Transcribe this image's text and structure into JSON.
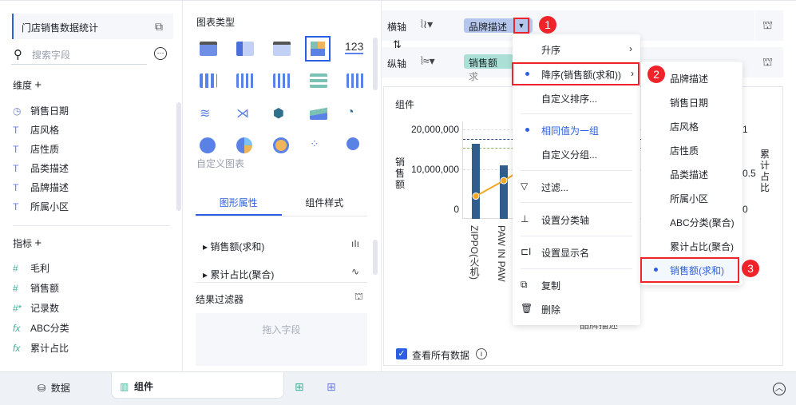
{
  "left": {
    "title": "门店销售数据统计",
    "search_placeholder": "搜索字段",
    "dimension_header": "维度",
    "dimensions": [
      "销售日期",
      "店风格",
      "店性质",
      "品类描述",
      "品牌描述",
      "所属小区"
    ],
    "measure_header": "指标",
    "measures": [
      "毛利",
      "销售额",
      "记录数",
      "ABC分类",
      "累计占比"
    ]
  },
  "middle": {
    "chart_type_title": "图表类型",
    "custom_chart": "自定义图表",
    "number_icon": "123",
    "tabs": [
      "图形属性",
      "组件样式"
    ],
    "properties": [
      "销售额(求和)",
      "累计占比(聚合)"
    ],
    "result_filter": "结果过滤器",
    "drop_hint": "拖入字段"
  },
  "axes": {
    "x_label": "横轴",
    "y_label": "纵轴",
    "x_field": "品牌描述",
    "y_field": "销售额",
    "y_field_suffix": "求"
  },
  "chart": {
    "title": "组件",
    "y_title": "销售额",
    "y2_title": "累计占比",
    "y_ticks": [
      "20,000,000",
      "10,000,000",
      "0"
    ],
    "y2_ticks": [
      "1",
      "0.5",
      "0"
    ],
    "categories": [
      "ZIPPO(火机)",
      "PAW IN PAW"
    ],
    "x_title": "品牌描述",
    "view_all": "查看所有数据",
    "bar_color": "#2f5d8c",
    "line_color": "#f5a623"
  },
  "chart_data": {
    "type": "bar",
    "categories": [
      "ZIPPO(火机)",
      "PAW IN PAW"
    ],
    "series": [
      {
        "values": [
          16500000,
          11000000
        ]
      },
      {
        "values": [
          0.17,
          0.37
        ]
      }
    ],
    "ylim": [
      0,
      20000000
    ],
    "y2lim": [
      0,
      1
    ],
    "ylabel": "销售额",
    "y2label": "累计占比",
    "xlabel": "品牌描述"
  },
  "menu": {
    "items": [
      "升序",
      "降序(销售额(求和))",
      "自定义排序...",
      "相同值为一组",
      "自定义分组...",
      "过滤...",
      "设置分类轴",
      "设置显示名",
      "复制",
      "删除"
    ]
  },
  "submenu": {
    "items": [
      "品牌描述",
      "销售日期",
      "店风格",
      "店性质",
      "品类描述",
      "所属小区",
      "ABC分类(聚合)",
      "累计占比(聚合)",
      "销售额(求和)"
    ]
  },
  "badges": [
    "1",
    "2",
    "3"
  ],
  "bottom": {
    "tabs": [
      "数据",
      "组件"
    ]
  },
  "colors": {
    "accent": "#2c60e0",
    "highlight": "#f0222a"
  }
}
